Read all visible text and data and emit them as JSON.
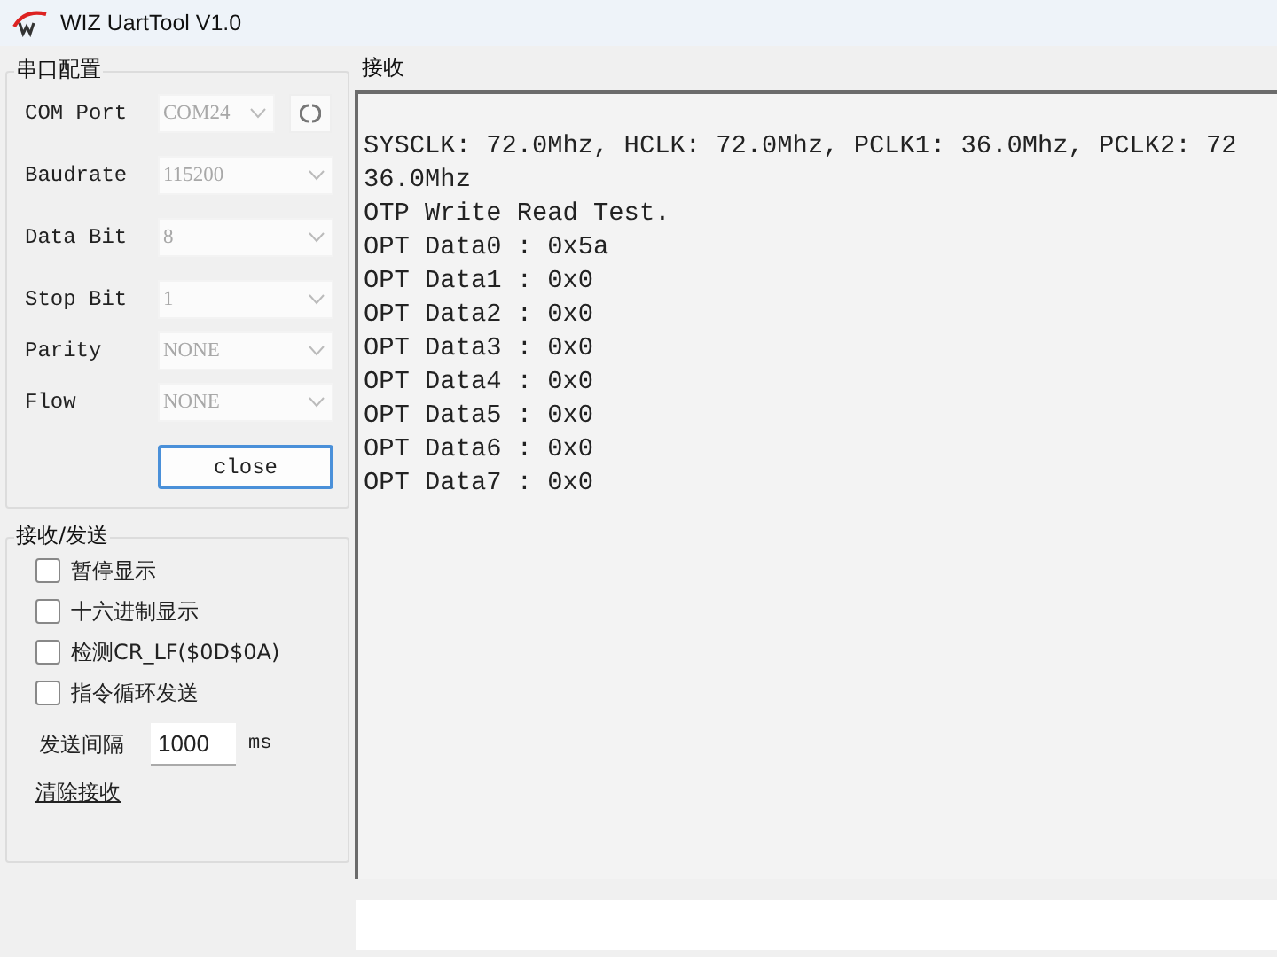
{
  "window": {
    "title": "WIZ UartTool V1.0"
  },
  "serial_config": {
    "title": "串口配置",
    "fields": [
      {
        "label": "COM Port",
        "value": "COM24",
        "disabled": true,
        "refresh": true
      },
      {
        "label": "Baudrate",
        "value": "115200",
        "disabled": true
      },
      {
        "label": "Data Bit",
        "value": "8",
        "disabled": true
      },
      {
        "label": "Stop Bit",
        "value": "1",
        "disabled": true
      },
      {
        "label": "Parity",
        "value": "NONE",
        "disabled": true
      },
      {
        "label": "Flow",
        "value": "NONE",
        "disabled": true
      }
    ],
    "button": "close"
  },
  "send_receive": {
    "title": "接收/发送",
    "options": [
      {
        "label": "暂停显示",
        "checked": false
      },
      {
        "label": "十六进制显示",
        "checked": false
      },
      {
        "label": "检测CR_LF($0D$0A)",
        "checked": false
      },
      {
        "label": "指令循环发送",
        "checked": false
      }
    ],
    "interval": {
      "label": "发送间隔",
      "value": "1000",
      "unit": "ms"
    },
    "clear_link": "清除接收"
  },
  "receive": {
    "title": "接收",
    "lines": [
      "SYSCLK: 72.0Mhz, HCLK: 72.0Mhz, PCLK1: 36.0Mhz, PCLK2: 72",
      "36.0Mhz",
      "OTP Write Read Test.",
      "OPT Data0 : 0x5a",
      "OPT Data1 : 0x0",
      "OPT Data2 : 0x0",
      "OPT Data3 : 0x0",
      "OPT Data4 : 0x0",
      "OPT Data5 : 0x0",
      "OPT Data6 : 0x0",
      "OPT Data7 : 0x0"
    ]
  }
}
